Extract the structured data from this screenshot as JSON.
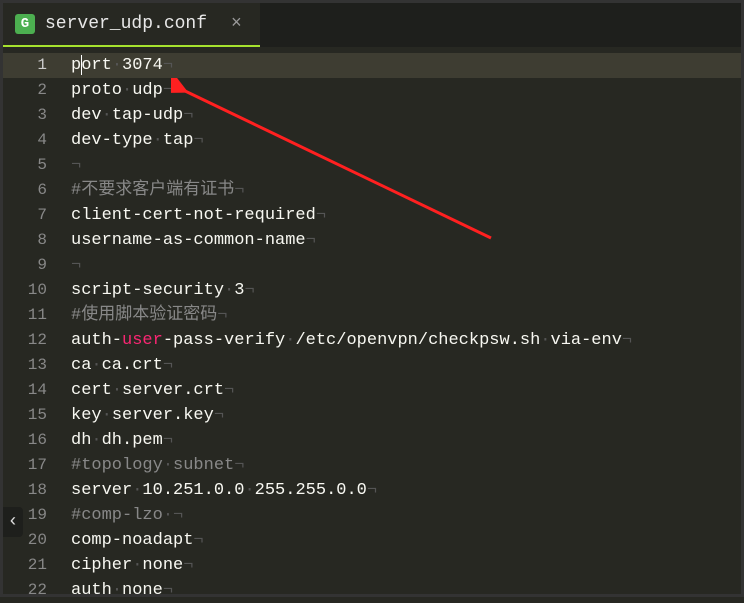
{
  "tab": {
    "title": "server_udp.conf",
    "icon_letter": "G",
    "close_glyph": "×"
  },
  "code": {
    "lines": [
      {
        "num": 1,
        "segments": [
          {
            "t": "p",
            "k": "plain"
          },
          {
            "t": "cursor"
          },
          {
            "t": "ort",
            "k": "plain"
          },
          {
            "t": "·",
            "k": "ws"
          },
          {
            "t": "3074",
            "k": "plain"
          },
          {
            "t": "¬",
            "k": "eol"
          }
        ],
        "current": true
      },
      {
        "num": 2,
        "segments": [
          {
            "t": "proto",
            "k": "plain"
          },
          {
            "t": "·",
            "k": "ws"
          },
          {
            "t": "udp",
            "k": "plain"
          },
          {
            "t": "¬",
            "k": "eol"
          }
        ]
      },
      {
        "num": 3,
        "segments": [
          {
            "t": "dev",
            "k": "plain"
          },
          {
            "t": "·",
            "k": "ws"
          },
          {
            "t": "tap-udp",
            "k": "plain"
          },
          {
            "t": "¬",
            "k": "eol"
          }
        ]
      },
      {
        "num": 4,
        "segments": [
          {
            "t": "dev-type",
            "k": "plain"
          },
          {
            "t": "·",
            "k": "ws"
          },
          {
            "t": "tap",
            "k": "plain"
          },
          {
            "t": "¬",
            "k": "eol"
          }
        ]
      },
      {
        "num": 5,
        "segments": [
          {
            "t": "¬",
            "k": "eol"
          }
        ]
      },
      {
        "num": 6,
        "segments": [
          {
            "t": "#不要求客户端有证书",
            "k": "comment"
          },
          {
            "t": "¬",
            "k": "eol"
          }
        ]
      },
      {
        "num": 7,
        "segments": [
          {
            "t": "client-cert-not-required",
            "k": "plain"
          },
          {
            "t": "¬",
            "k": "eol"
          }
        ]
      },
      {
        "num": 8,
        "segments": [
          {
            "t": "username-as-common-name",
            "k": "plain"
          },
          {
            "t": "¬",
            "k": "eol"
          }
        ]
      },
      {
        "num": 9,
        "segments": [
          {
            "t": "¬",
            "k": "eol"
          }
        ]
      },
      {
        "num": 10,
        "segments": [
          {
            "t": "script-security",
            "k": "plain"
          },
          {
            "t": "·",
            "k": "ws"
          },
          {
            "t": "3",
            "k": "plain"
          },
          {
            "t": "¬",
            "k": "eol"
          }
        ]
      },
      {
        "num": 11,
        "segments": [
          {
            "t": "#使用脚本验证密码",
            "k": "comment"
          },
          {
            "t": "¬",
            "k": "eol"
          }
        ]
      },
      {
        "num": 12,
        "segments": [
          {
            "t": "auth-",
            "k": "plain"
          },
          {
            "t": "user",
            "k": "user"
          },
          {
            "t": "-pass-verify",
            "k": "plain"
          },
          {
            "t": "·",
            "k": "ws"
          },
          {
            "t": "/etc/openvpn/checkpsw.sh",
            "k": "plain"
          },
          {
            "t": "·",
            "k": "ws"
          },
          {
            "t": "via-env",
            "k": "plain"
          },
          {
            "t": "¬",
            "k": "eol"
          }
        ]
      },
      {
        "num": 13,
        "segments": [
          {
            "t": "ca",
            "k": "plain"
          },
          {
            "t": "·",
            "k": "ws"
          },
          {
            "t": "ca.crt",
            "k": "plain"
          },
          {
            "t": "¬",
            "k": "eol"
          }
        ]
      },
      {
        "num": 14,
        "segments": [
          {
            "t": "cert",
            "k": "plain"
          },
          {
            "t": "·",
            "k": "ws"
          },
          {
            "t": "server.crt",
            "k": "plain"
          },
          {
            "t": "¬",
            "k": "eol"
          }
        ]
      },
      {
        "num": 15,
        "segments": [
          {
            "t": "key",
            "k": "plain"
          },
          {
            "t": "·",
            "k": "ws"
          },
          {
            "t": "server.key",
            "k": "plain"
          },
          {
            "t": "¬",
            "k": "eol"
          }
        ]
      },
      {
        "num": 16,
        "segments": [
          {
            "t": "dh",
            "k": "plain"
          },
          {
            "t": "·",
            "k": "ws"
          },
          {
            "t": "dh.pem",
            "k": "plain"
          },
          {
            "t": "¬",
            "k": "eol"
          }
        ]
      },
      {
        "num": 17,
        "segments": [
          {
            "t": "#topology",
            "k": "comment"
          },
          {
            "t": "·",
            "k": "ws"
          },
          {
            "t": "subnet",
            "k": "comment"
          },
          {
            "t": "¬",
            "k": "eol"
          }
        ]
      },
      {
        "num": 18,
        "segments": [
          {
            "t": "server",
            "k": "plain"
          },
          {
            "t": "·",
            "k": "ws"
          },
          {
            "t": "10.251.0.0",
            "k": "plain"
          },
          {
            "t": "·",
            "k": "ws"
          },
          {
            "t": "255.255.0.0",
            "k": "plain"
          },
          {
            "t": "¬",
            "k": "eol"
          }
        ]
      },
      {
        "num": 19,
        "segments": [
          {
            "t": "#comp-lzo",
            "k": "comment"
          },
          {
            "t": "·",
            "k": "ws"
          },
          {
            "t": "¬",
            "k": "eol"
          }
        ]
      },
      {
        "num": 20,
        "segments": [
          {
            "t": "comp-noadapt",
            "k": "plain"
          },
          {
            "t": "¬",
            "k": "eol"
          }
        ]
      },
      {
        "num": 21,
        "segments": [
          {
            "t": "cipher",
            "k": "plain"
          },
          {
            "t": "·",
            "k": "ws"
          },
          {
            "t": "none",
            "k": "plain"
          },
          {
            "t": "¬",
            "k": "eol"
          }
        ]
      },
      {
        "num": 22,
        "segments": [
          {
            "t": "auth",
            "k": "plain"
          },
          {
            "t": "·",
            "k": "ws"
          },
          {
            "t": "none",
            "k": "plain"
          },
          {
            "t": "¬",
            "k": "eol"
          }
        ]
      }
    ]
  },
  "fold_handle_glyph": "‹"
}
